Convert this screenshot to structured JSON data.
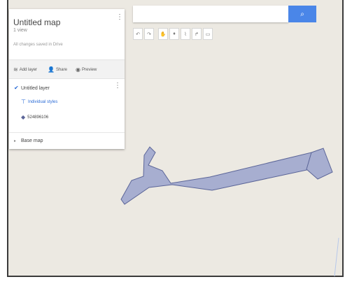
{
  "panel": {
    "title": "Untitled map",
    "views": "1 view",
    "saved": "All changes saved in Drive",
    "actions": {
      "add_layer": "Add layer",
      "share": "Share",
      "preview": "Preview"
    },
    "layer": {
      "name": "Untitled layer",
      "style": "Individual styles",
      "feature": "524896106"
    },
    "base_map": "Base map"
  },
  "search": {
    "placeholder": ""
  },
  "toolbar": {
    "tools": [
      "undo-icon",
      "redo-icon",
      "hand-icon",
      "marker-icon",
      "line-icon",
      "directions-icon",
      "ruler-icon"
    ]
  },
  "map": {
    "shape_color": "#a7aed0",
    "shape_stroke": "#5b6598",
    "accent": "#4a86e8"
  }
}
